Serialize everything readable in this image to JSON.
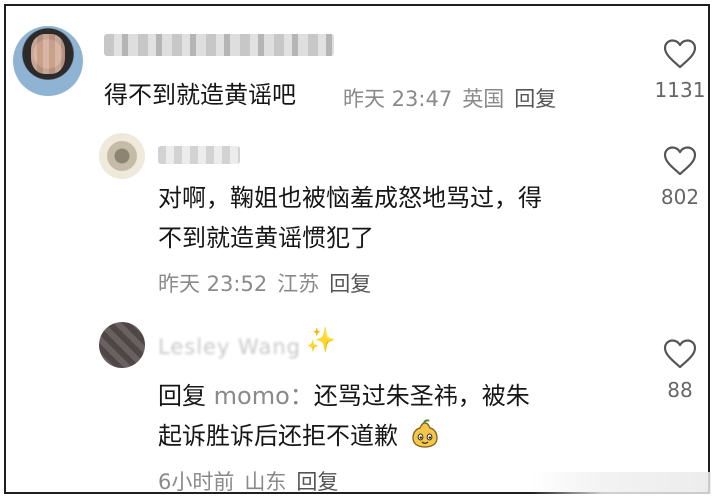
{
  "comments": [
    {
      "username": "",
      "text_lines": [
        "得不到就造黄谣吧"
      ],
      "time": "昨天 23:47",
      "location": "英国",
      "reply_label": "回复",
      "likes": "1131"
    },
    {
      "username": "",
      "text_lines": [
        "对啊，鞠姐也被恼羞成怒地骂过，得",
        "不到就造黄谣惯犯了"
      ],
      "time": "昨天 23:52",
      "location": "江苏",
      "reply_label": "回复",
      "likes": "802"
    },
    {
      "username": "Lesley Wang",
      "reply_prefix": "回复",
      "reply_target": "momo：",
      "text_lines": [
        "还骂过朱圣祎，被朱",
        "起诉胜诉后还拒不道歉"
      ],
      "time": "6小时前",
      "location": "山东",
      "reply_label": "回复",
      "likes": "88"
    }
  ],
  "icons": {
    "like": "heart-outline-icon",
    "sticker": "cute-pear-emoji",
    "username_emoji": "sparkles-icon"
  },
  "colors": {
    "text": "#161616",
    "meta": "#8a8a8a",
    "border": "#1f1f1f"
  }
}
